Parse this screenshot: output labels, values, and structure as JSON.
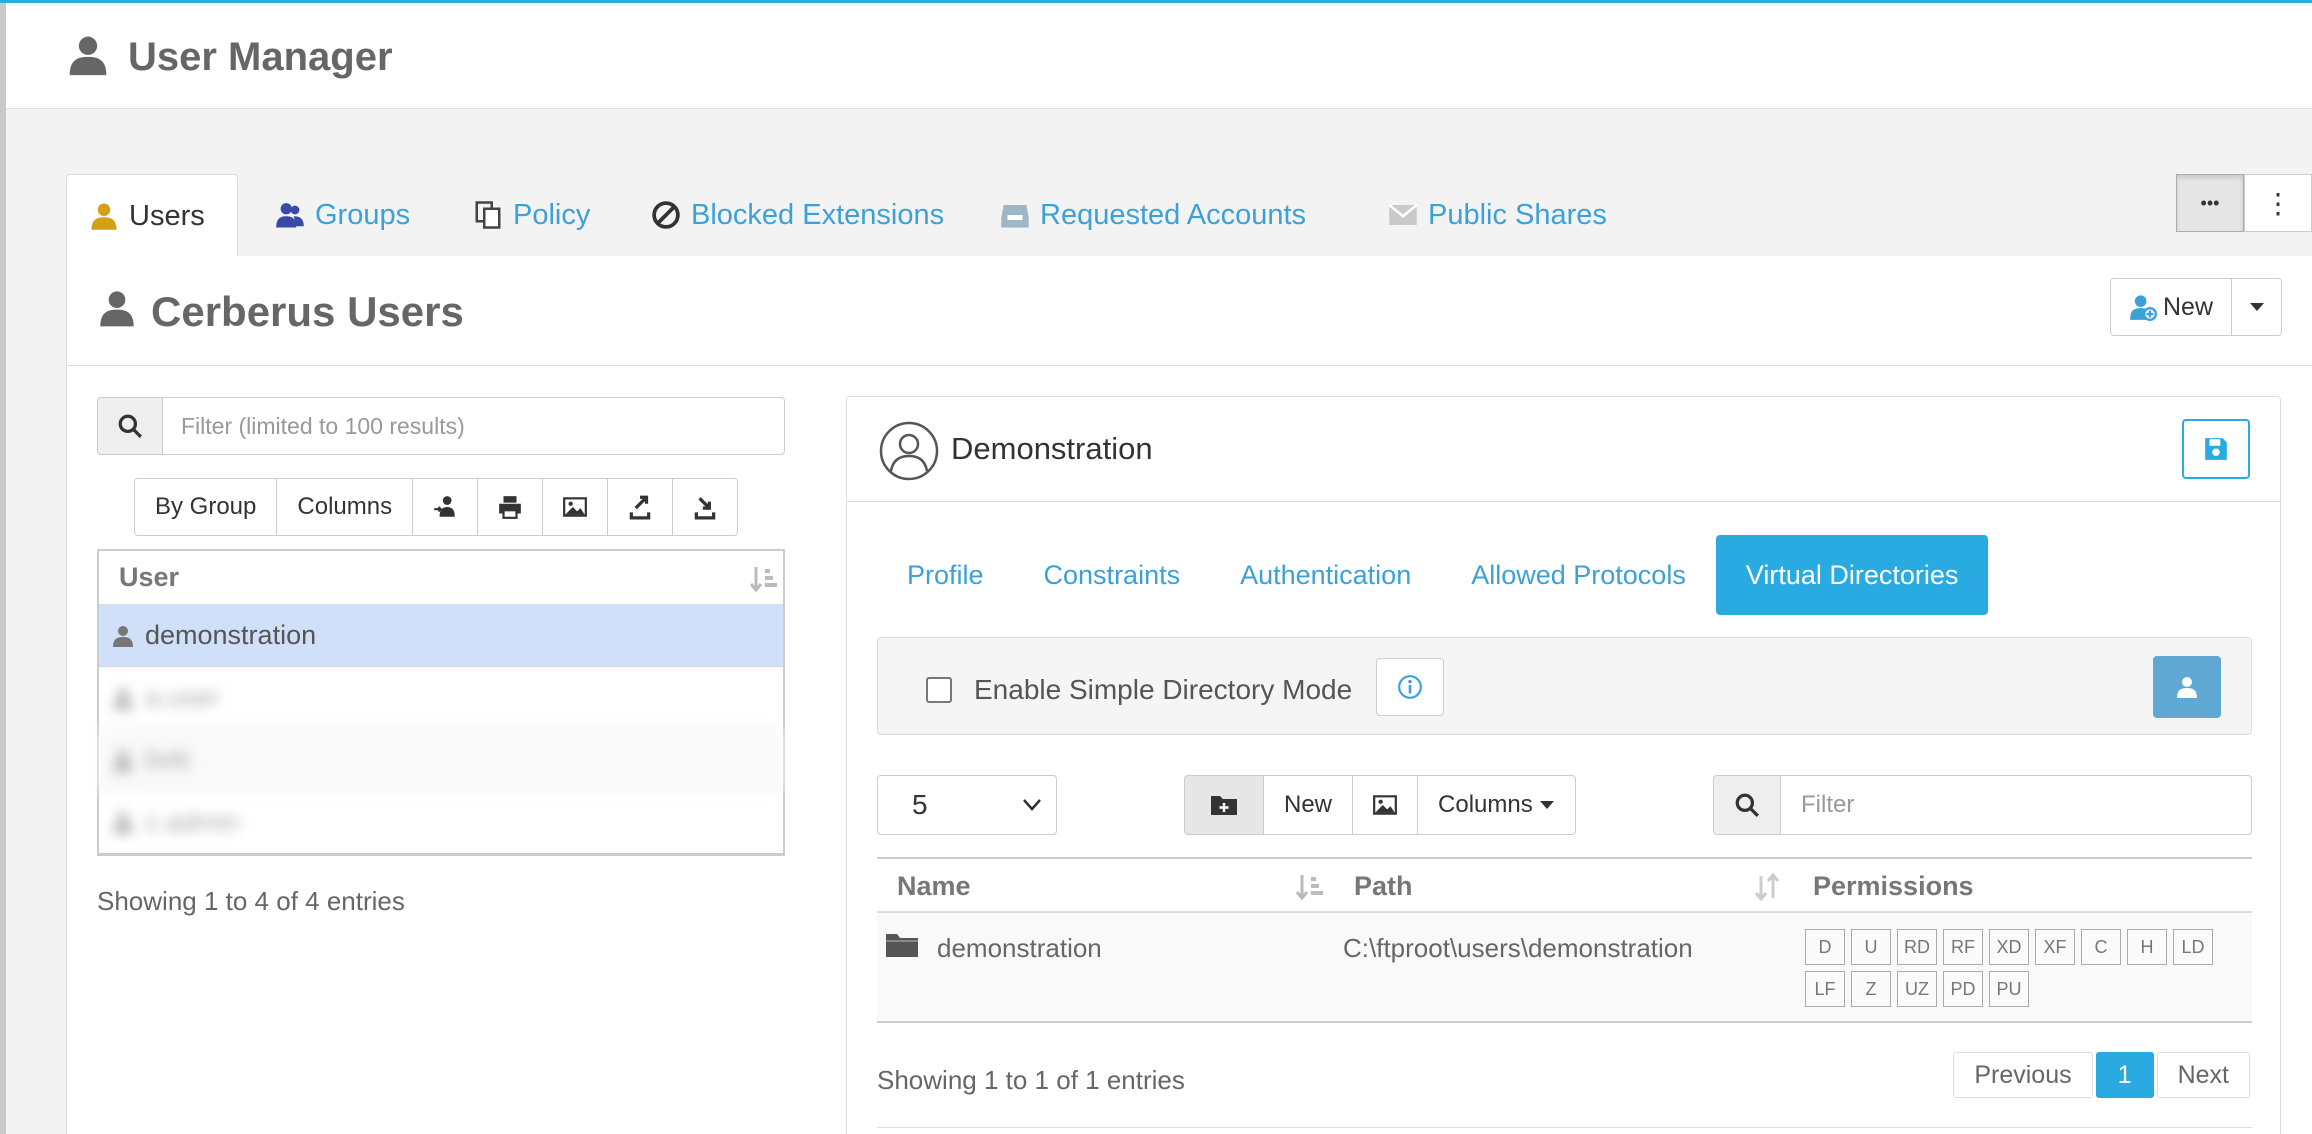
{
  "app": {
    "title": "User Manager"
  },
  "tabs": [
    {
      "label": "Users"
    },
    {
      "label": "Groups"
    },
    {
      "label": "Policy"
    },
    {
      "label": "Blocked Extensions"
    },
    {
      "label": "Requested  Accounts"
    },
    {
      "label": "Public Shares"
    }
  ],
  "tab_actions": {
    "more": "•••",
    "kebab": "⋮"
  },
  "panel": {
    "title": "Cerberus Users",
    "new_label": "New"
  },
  "user_list": {
    "filter_placeholder": "Filter (limited to 100 results)",
    "tools": {
      "by_group": "By Group",
      "columns": "Columns"
    },
    "column_header": "User",
    "rows": [
      {
        "name": "demonstration"
      },
      {
        "name": "a.user"
      },
      {
        "name": "bob"
      },
      {
        "name": "c.admin"
      }
    ],
    "info": "Showing 1 to 4 of 4 entries"
  },
  "detail": {
    "name": "Demonstration",
    "tabs": [
      {
        "label": "Profile"
      },
      {
        "label": "Constraints"
      },
      {
        "label": "Authentication"
      },
      {
        "label": "Allowed Protocols"
      },
      {
        "label": "Virtual Directories"
      }
    ],
    "simple_mode_label": "Enable Simple Directory Mode",
    "page_size": "5",
    "tools": {
      "new": "New",
      "columns": "Columns"
    },
    "filter_placeholder": "Filter",
    "columns": {
      "name": "Name",
      "path": "Path",
      "permissions": "Permissions"
    },
    "rows": [
      {
        "name": "demonstration",
        "path": "C:\\ftproot\\users\\demonstration",
        "permissions": [
          "D",
          "U",
          "RD",
          "RF",
          "XD",
          "XF",
          "C",
          "H",
          "LD",
          "LF",
          "Z",
          "UZ",
          "PD",
          "PU"
        ]
      }
    ],
    "info": "Showing 1 to 1 of 1 entries",
    "pager": {
      "previous": "Previous",
      "page": "1",
      "next": "Next"
    }
  },
  "colors": {
    "accent": "#29abe2",
    "link": "#3ba1d8",
    "selected_row": "#cfe0f8"
  }
}
